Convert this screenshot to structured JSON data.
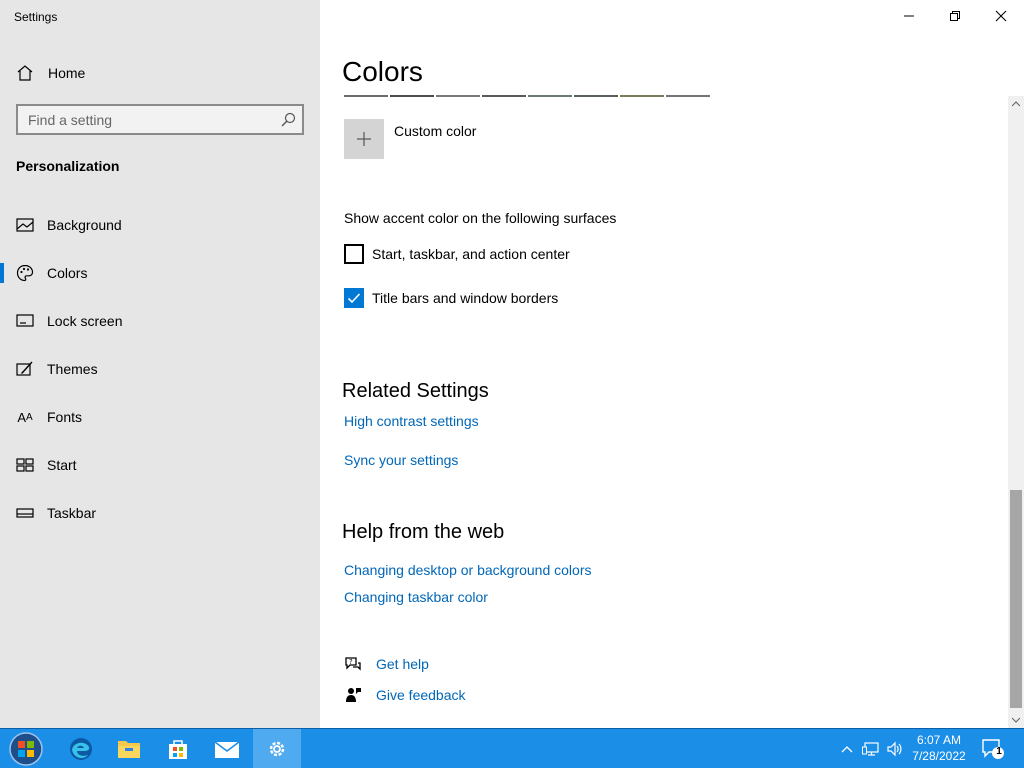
{
  "window": {
    "title": "Settings"
  },
  "sidebar": {
    "home_label": "Home",
    "search_placeholder": "Find a setting",
    "section_title": "Personalization",
    "items": [
      {
        "label": "Background",
        "icon": "picture-icon",
        "active": false
      },
      {
        "label": "Colors",
        "icon": "palette-icon",
        "active": true
      },
      {
        "label": "Lock screen",
        "icon": "lock-screen-icon",
        "active": false
      },
      {
        "label": "Themes",
        "icon": "brush-icon",
        "active": false
      },
      {
        "label": "Fonts",
        "icon": "font-icon",
        "active": false
      },
      {
        "label": "Start",
        "icon": "start-grid-icon",
        "active": false
      },
      {
        "label": "Taskbar",
        "icon": "taskbar-icon",
        "active": false
      }
    ]
  },
  "main": {
    "page_title": "Colors",
    "swatch_colors": [
      "#6b6b6b",
      "#4c4c4c",
      "#7a7a7a",
      "#5a5a5a",
      "#6d7a72",
      "#5a605c",
      "#7b7a5a",
      "#747474"
    ],
    "custom_color_label": "Custom color",
    "surfaces_label": "Show accent color on the following surfaces",
    "checkboxes": [
      {
        "label": "Start, taskbar, and action center",
        "checked": false
      },
      {
        "label": "Title bars and window borders",
        "checked": true
      }
    ],
    "related_title": "Related Settings",
    "related_links": [
      "High contrast settings",
      "Sync your settings"
    ],
    "help_title": "Help from the web",
    "help_links": [
      "Changing desktop or background colors",
      "Changing taskbar color"
    ],
    "get_help_label": "Get help",
    "give_feedback_label": "Give feedback"
  },
  "taskbar": {
    "apps": [
      "edge-icon",
      "file-explorer-icon",
      "store-icon",
      "mail-icon",
      "settings-icon"
    ],
    "time": "6:07 AM",
    "date": "7/28/2022",
    "notification_count": "1",
    "accent": "#1b8ee8"
  },
  "accent_color": "#0078d4",
  "link_color": "#0067b8"
}
